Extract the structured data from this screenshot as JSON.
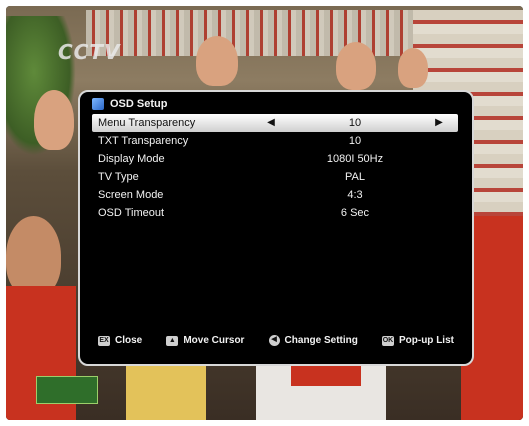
{
  "channel_logo": "CCTV",
  "osd": {
    "title": "OSD Setup",
    "rows": [
      {
        "label": "Menu Transparency",
        "value": "10",
        "selected": true
      },
      {
        "label": "TXT Transparency",
        "value": "10",
        "selected": false
      },
      {
        "label": "Display Mode",
        "value": "1080I 50Hz",
        "selected": false
      },
      {
        "label": "TV Type",
        "value": "PAL",
        "selected": false
      },
      {
        "label": "Screen Mode",
        "value": "4:3",
        "selected": false
      },
      {
        "label": "OSD Timeout",
        "value": "6 Sec",
        "selected": false
      }
    ],
    "footer": [
      {
        "key": "EX",
        "label": "Close"
      },
      {
        "key": "▲",
        "label": "Move Cursor"
      },
      {
        "key": "◀",
        "label": "Change Setting"
      },
      {
        "key": "OK",
        "label": "Pop-up List"
      }
    ]
  },
  "colors": {
    "panel_bg": "#000000",
    "panel_border": "#d8d8d8",
    "highlight": "#e8e8e8"
  }
}
